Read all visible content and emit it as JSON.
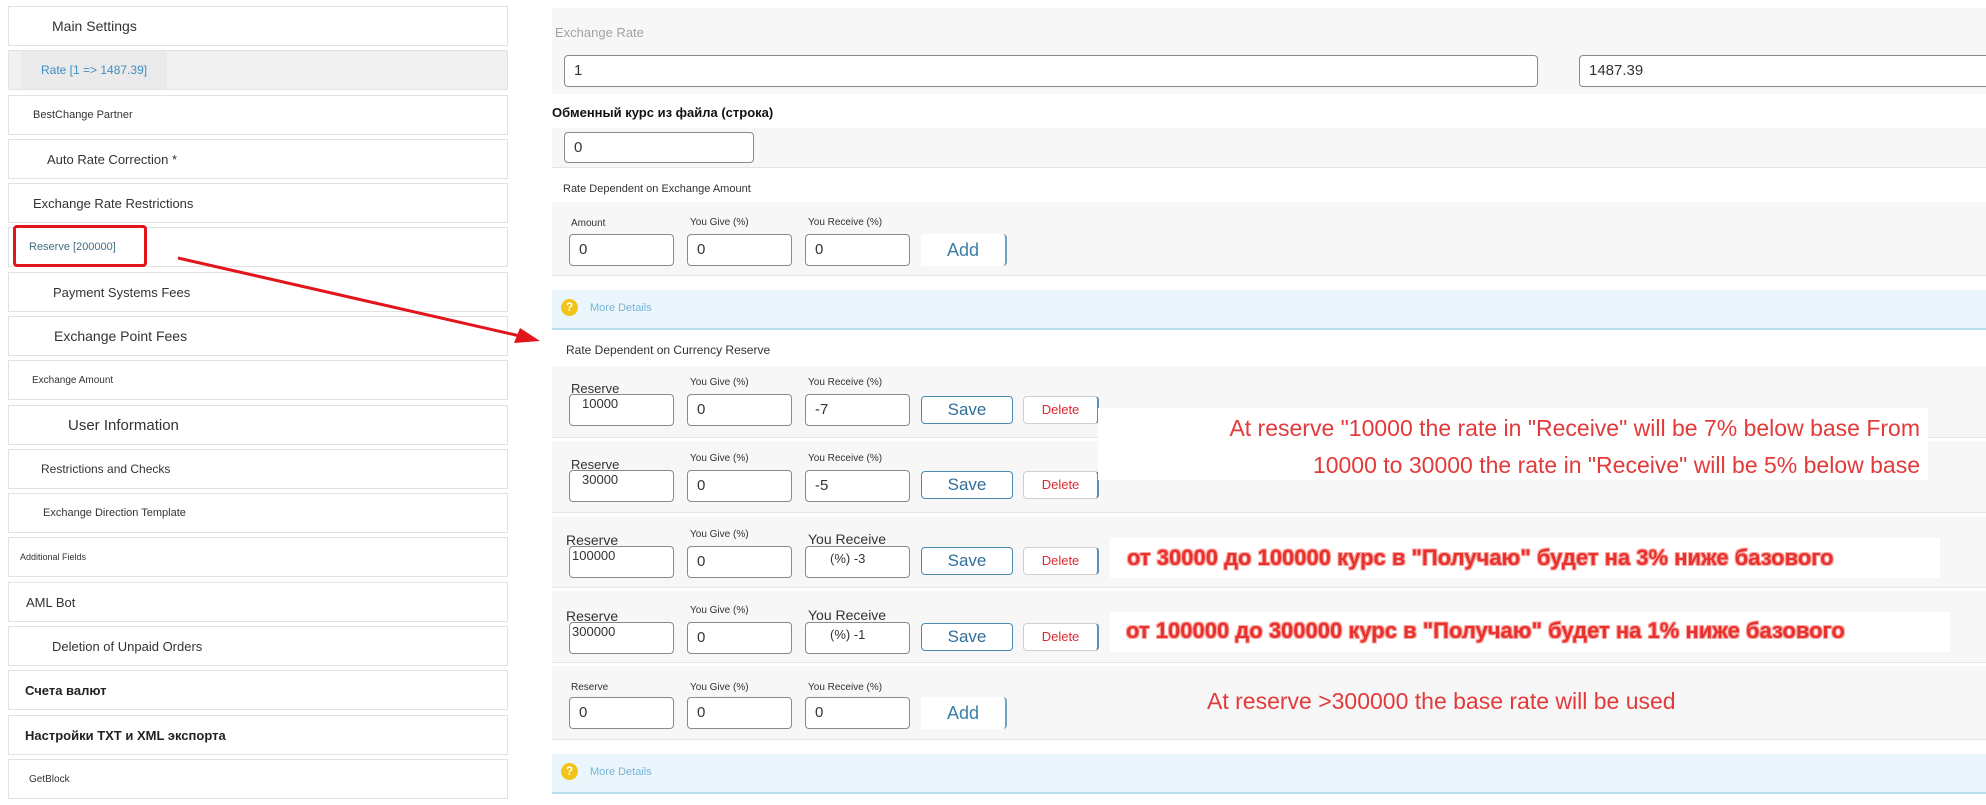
{
  "sidebar": {
    "items": [
      {
        "label": "Main Settings"
      },
      {
        "label": "Rate [1 => 1487.39]"
      },
      {
        "label": "BestChange Partner"
      },
      {
        "label": "Auto Rate Correction *"
      },
      {
        "label": "Exchange Rate Restrictions"
      },
      {
        "label": "Reserve [200000]"
      },
      {
        "label": "Payment Systems Fees"
      },
      {
        "label": "Exchange Point Fees"
      },
      {
        "label": "Exchange Amount"
      },
      {
        "label": "User Information"
      },
      {
        "label": "Restrictions and Checks"
      },
      {
        "label": "Exchange Direction Template"
      },
      {
        "label": "Additional Fields"
      },
      {
        "label": "AML Bot"
      },
      {
        "label": "Deletion of Unpaid Orders"
      },
      {
        "label": "Счета валют"
      },
      {
        "label": "Настройки TXT и XML экспорта"
      },
      {
        "label": "GetBlock"
      }
    ]
  },
  "exchange_rate": {
    "heading": "Exchange Rate",
    "give_value": "1",
    "receive_value": "1487.39",
    "file_rate_label": "Обменный курс из файла (строка)",
    "file_rate_value": "0"
  },
  "amount_section": {
    "title": "Rate Dependent on Exchange Amount",
    "amount_label": "Amount",
    "give_label": "You Give (%)",
    "receive_label": "You Receive (%)",
    "amount_value": "0",
    "give_value": "0",
    "receive_value": "0",
    "add_label": "Add",
    "more_label": "More Details"
  },
  "reserve_section": {
    "title": "Rate Dependent on Currency Reserve",
    "rows": [
      {
        "reserve_label": "Reserve",
        "reserve_value": "10000",
        "give_label": "You Give (%)",
        "give_value": "0",
        "receive_label": "You Receive (%)",
        "receive_value": "-7",
        "save_label": "Save",
        "delete_label": "Delete"
      },
      {
        "reserve_label": "Reserve",
        "reserve_value": "30000",
        "give_label": "You Give (%)",
        "give_value": "0",
        "receive_label": "You Receive (%)",
        "receive_value": "-5",
        "save_label": "Save",
        "delete_label": "Delete"
      },
      {
        "reserve_label": "Reserve",
        "reserve_value": "100000",
        "give_label": "You Give (%)",
        "give_value": "0",
        "receive_label": "You Receive",
        "receive_value": "(%) -3",
        "save_label": "Save",
        "delete_label": "Delete"
      },
      {
        "reserve_label": "Reserve",
        "reserve_value": "300000",
        "give_label": "You Give (%)",
        "give_value": "0",
        "receive_label": "You Receive",
        "receive_value": "(%) -1",
        "save_label": "Save",
        "delete_label": "Delete"
      }
    ],
    "new_row": {
      "reserve_label": "Reserve",
      "reserve_value": "0",
      "give_label": "You Give (%)",
      "give_value": "0",
      "receive_label": "You Receive (%)",
      "receive_value": "0",
      "add_label": "Add"
    },
    "more_label": "More Details"
  },
  "annotations": {
    "line1": "At reserve \"10000 the rate in \"Receive\" will be 7% below base From",
    "line2": "10000 to 30000 the rate in \"Receive\" will be 5% below base",
    "line3": "от 30000 до 100000 курс в \"Получаю\" будет на 3% ниже базового",
    "line4": "от 100000 до 300000 курс в \"Получаю\" будет на 1% ниже базового",
    "line5": "At reserve >300000 the base rate will be used",
    "color": "#e23a3a"
  }
}
